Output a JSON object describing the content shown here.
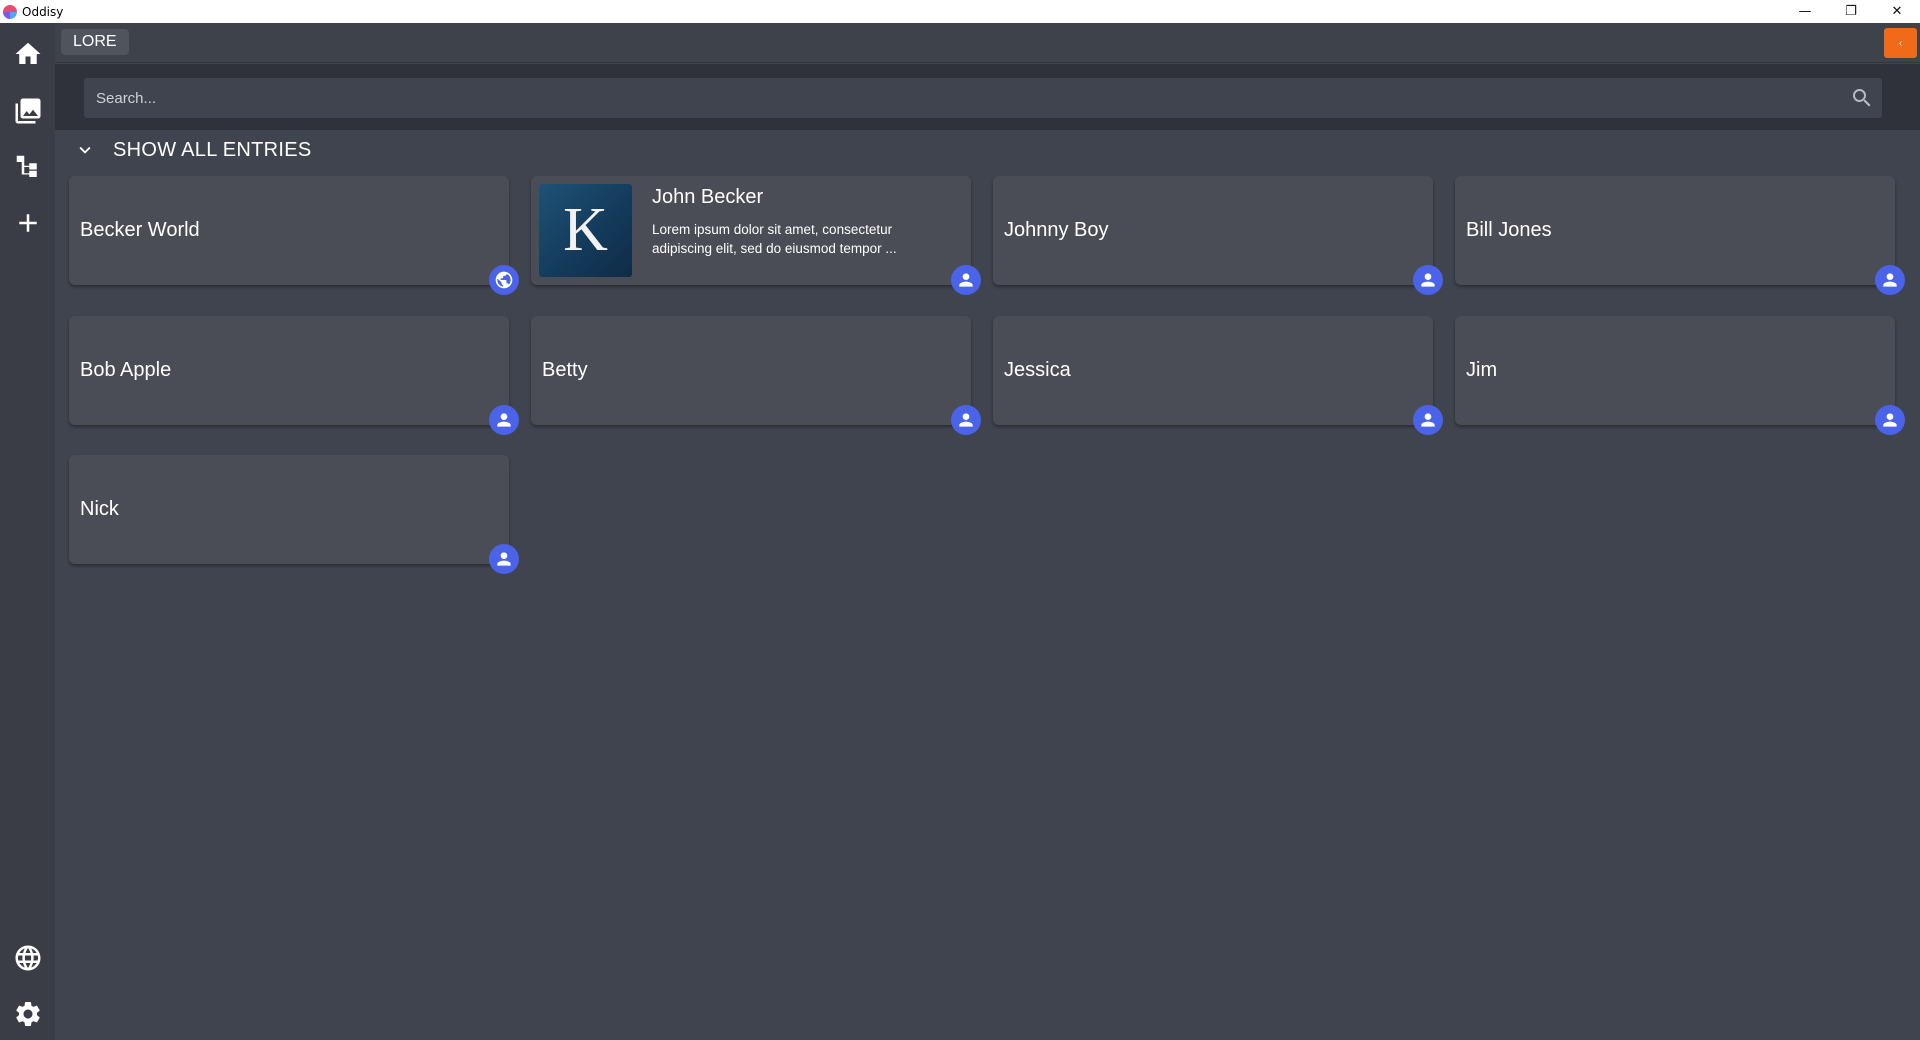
{
  "window": {
    "app_name": "Oddisy",
    "controls": {
      "minimize": "—",
      "restore": "❐",
      "close": "✕"
    }
  },
  "sidebar": {
    "items": [
      {
        "id": "home",
        "icon": "home-icon"
      },
      {
        "id": "gallery",
        "icon": "image-library-icon"
      },
      {
        "id": "tree",
        "icon": "hierarchy-icon"
      },
      {
        "id": "add",
        "icon": "plus-icon"
      },
      {
        "id": "world",
        "icon": "globe-icon"
      },
      {
        "id": "settings",
        "icon": "gear-icon"
      }
    ]
  },
  "header": {
    "lore_label": "LORE",
    "collapse_glyph": "‹",
    "accent_color": "#f06a1a"
  },
  "search": {
    "placeholder": "Search..."
  },
  "section": {
    "title": "SHOW ALL ENTRIES"
  },
  "entries": [
    {
      "name": "Becker World",
      "type": "world",
      "icon": "globe-icon"
    },
    {
      "name": "John Becker",
      "type": "character",
      "icon": "person-icon",
      "thumb_letter": "K",
      "description": "Lorem ipsum dolor sit amet, consectetur adipiscing elit, sed do eiusmod tempor ..."
    },
    {
      "name": "Johnny Boy",
      "type": "character",
      "icon": "person-icon"
    },
    {
      "name": "Bill Jones",
      "type": "character",
      "icon": "person-icon"
    },
    {
      "name": "Bob Apple",
      "type": "character",
      "icon": "person-icon"
    },
    {
      "name": "Betty",
      "type": "character",
      "icon": "person-icon"
    },
    {
      "name": "Jessica",
      "type": "character",
      "icon": "person-icon"
    },
    {
      "name": "Jim",
      "type": "character",
      "icon": "person-icon"
    },
    {
      "name": "Nick",
      "type": "character",
      "icon": "person-icon"
    }
  ],
  "colors": {
    "badge": "#4b63e8",
    "card": "#4a4d56",
    "background": "#40444e"
  }
}
